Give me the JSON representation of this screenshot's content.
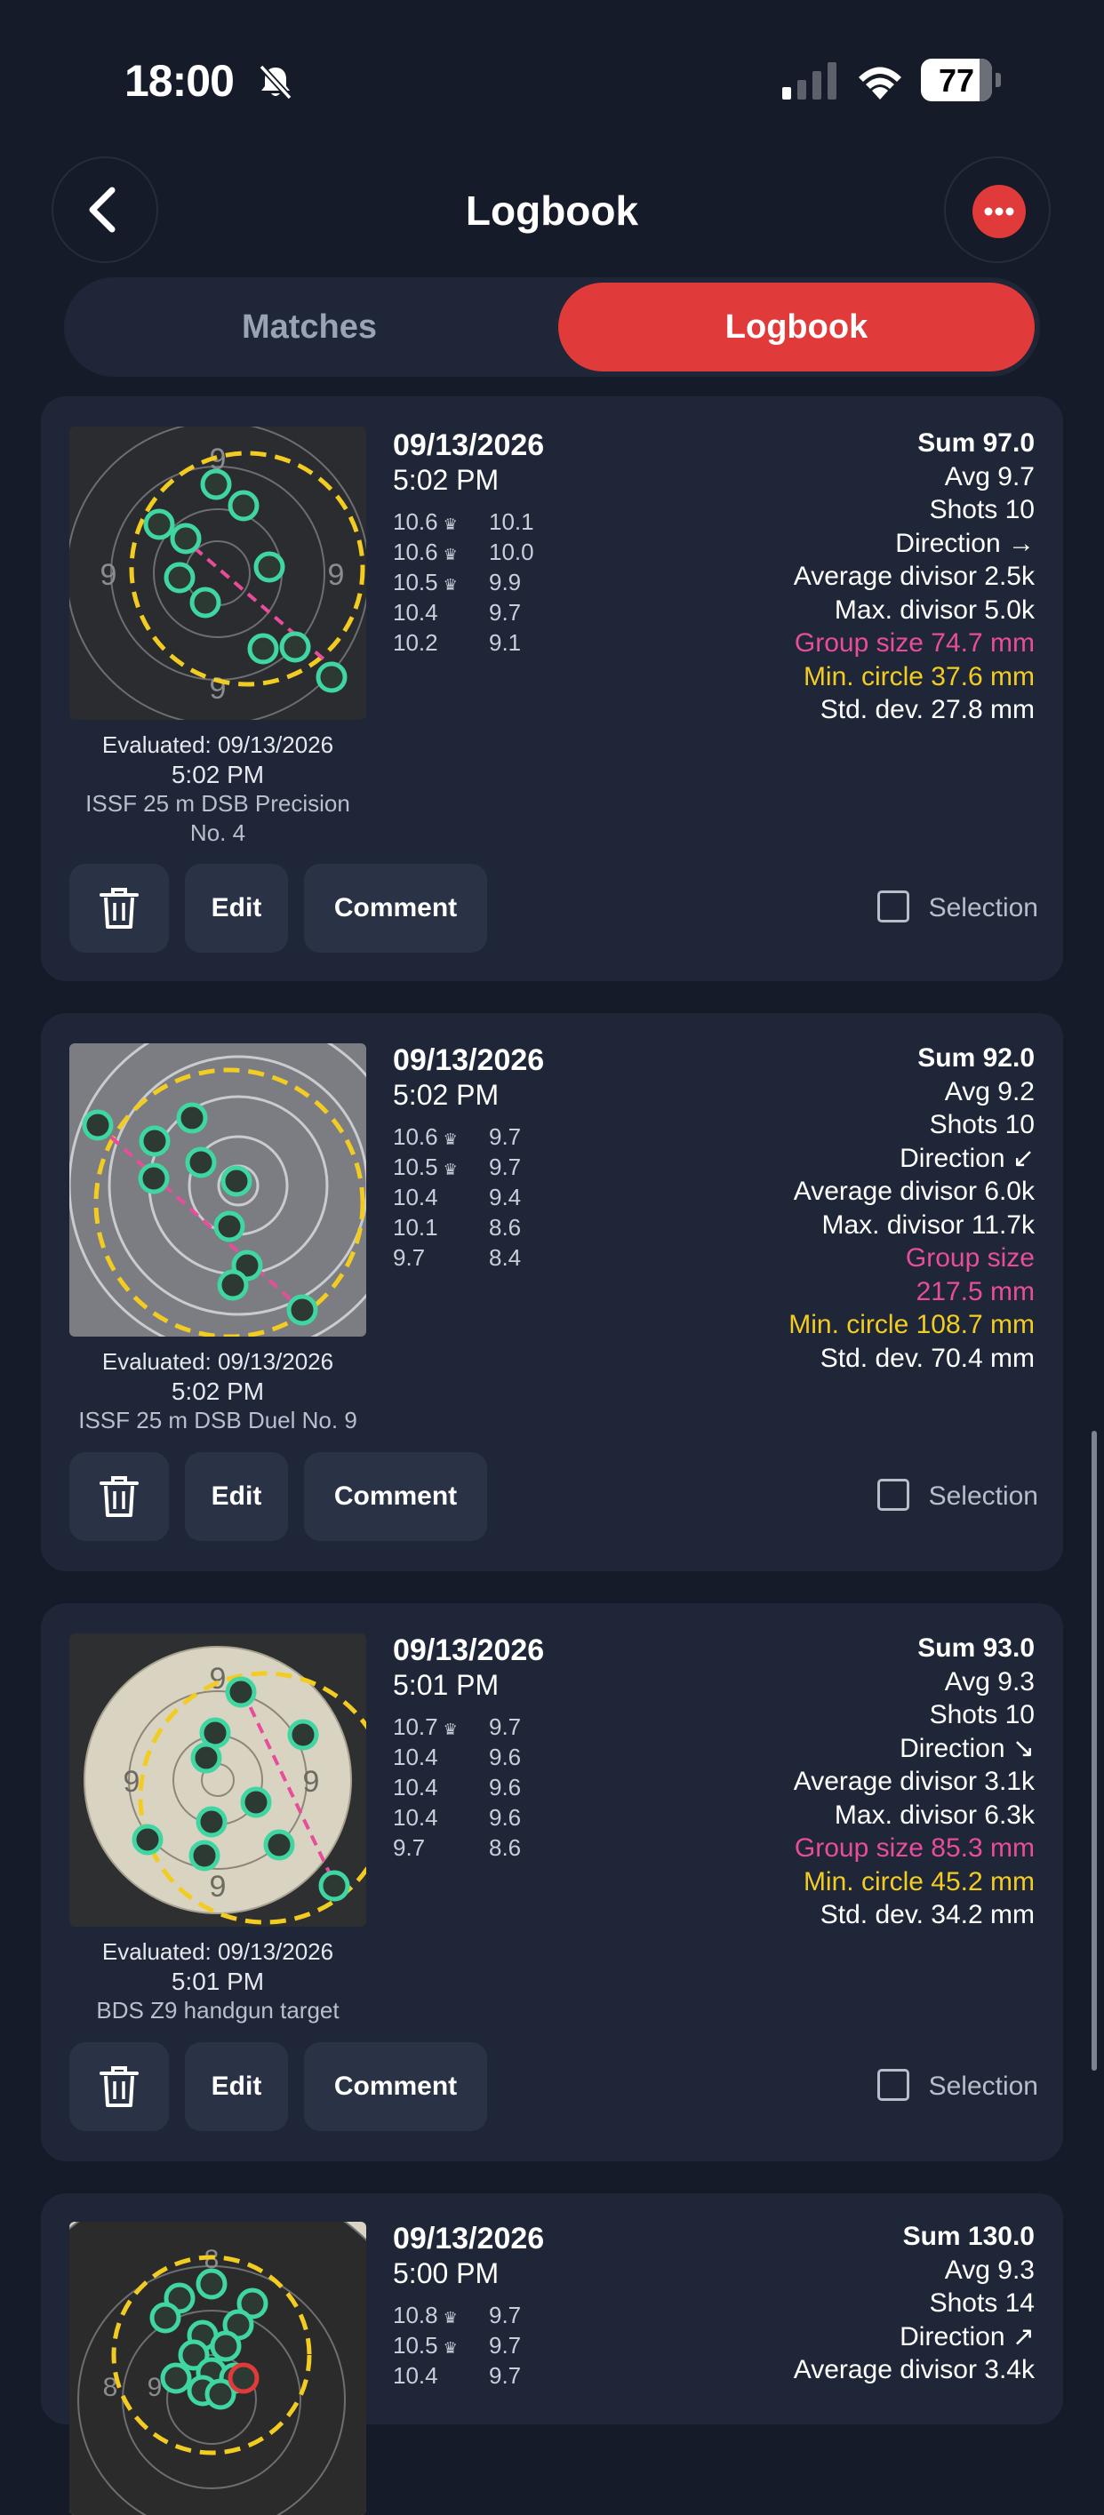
{
  "status_bar": {
    "time": "18:00",
    "battery": "77",
    "battery_level": 0.77,
    "icons": [
      "bell-slash-icon",
      "cellular-signal-icon",
      "wifi-icon",
      "battery-icon"
    ]
  },
  "nav": {
    "title": "Logbook",
    "back_icon": "chevron-left-icon",
    "more_icon": "ellipsis-icon"
  },
  "tabs": [
    {
      "label": "Matches",
      "selected": false
    },
    {
      "label": "Logbook",
      "selected": true
    }
  ],
  "colors": {
    "background": "#151b28",
    "card": "#1e2637",
    "accent": "#e03a3a",
    "group_size": "#e84d9c",
    "min_circle": "#f3cc22",
    "shot_marker": "#3fd6a2"
  },
  "entries": [
    {
      "date": "09/13/2026",
      "time": "5:02 PM",
      "evaluated": "Evaluated: 09/13/2026",
      "evaluated_time": "5:02 PM",
      "target": "ISSF 25 m DSB Precision No. 4",
      "shots": [
        {
          "a": "10.6",
          "a_crown": true,
          "b": "10.1"
        },
        {
          "a": "10.6",
          "a_crown": true,
          "b": "10.0"
        },
        {
          "a": "10.5",
          "a_crown": true,
          "b": "9.9"
        },
        {
          "a": "10.4",
          "a_crown": false,
          "b": "9.7"
        },
        {
          "a": "10.2",
          "a_crown": false,
          "b": "9.1"
        }
      ],
      "stats": {
        "sum": "Sum 97.0",
        "avg": "Avg 9.7",
        "shots": "Shots 10",
        "direction": "Direction →",
        "avg_divisor": "Average divisor 2.5k",
        "max_divisor": "Max. divisor 5.0k",
        "group_size": "Group size 74.7 mm",
        "min_circle": "Min. circle 37.6 mm",
        "std_dev": "Std. dev. 27.8 mm"
      },
      "actions": {
        "edit": "Edit",
        "comment": "Comment",
        "selection": "Selection"
      }
    },
    {
      "date": "09/13/2026",
      "time": "5:02 PM",
      "evaluated": "Evaluated: 09/13/2026",
      "evaluated_time": "5:02 PM",
      "target": "ISSF 25 m DSB Duel No. 9",
      "shots": [
        {
          "a": "10.6",
          "a_crown": true,
          "b": "9.7"
        },
        {
          "a": "10.5",
          "a_crown": true,
          "b": "9.7"
        },
        {
          "a": "10.4",
          "a_crown": false,
          "b": "9.4"
        },
        {
          "a": "10.1",
          "a_crown": false,
          "b": "8.6"
        },
        {
          "a": "9.7",
          "a_crown": false,
          "b": "8.4"
        }
      ],
      "stats": {
        "sum": "Sum 92.0",
        "avg": "Avg 9.2",
        "shots": "Shots 10",
        "direction": "Direction ↙",
        "avg_divisor": "Average divisor 6.0k",
        "max_divisor": "Max. divisor 11.7k",
        "group_size_line1": "Group size",
        "group_size_line2": "217.5 mm",
        "min_circle": "Min. circle 108.7 mm",
        "std_dev": "Std. dev. 70.4 mm"
      },
      "actions": {
        "edit": "Edit",
        "comment": "Comment",
        "selection": "Selection"
      }
    },
    {
      "date": "09/13/2026",
      "time": "5:01 PM",
      "evaluated": "Evaluated: 09/13/2026",
      "evaluated_time": "5:01 PM",
      "target": "BDS Z9 handgun target",
      "shots": [
        {
          "a": "10.7",
          "a_crown": true,
          "b": "9.7"
        },
        {
          "a": "10.4",
          "a_crown": false,
          "b": "9.6"
        },
        {
          "a": "10.4",
          "a_crown": false,
          "b": "9.6"
        },
        {
          "a": "10.4",
          "a_crown": false,
          "b": "9.6"
        },
        {
          "a": "9.7",
          "a_crown": false,
          "b": "8.6"
        }
      ],
      "stats": {
        "sum": "Sum 93.0",
        "avg": "Avg 9.3",
        "shots": "Shots 10",
        "direction": "Direction ↘",
        "avg_divisor": "Average divisor 3.1k",
        "max_divisor": "Max. divisor 6.3k",
        "group_size": "Group size 85.3 mm",
        "min_circle": "Min. circle 45.2 mm",
        "std_dev": "Std. dev. 34.2 mm"
      },
      "actions": {
        "edit": "Edit",
        "comment": "Comment",
        "selection": "Selection"
      }
    },
    {
      "date": "09/13/2026",
      "time": "5:00 PM",
      "shots": [
        {
          "a": "10.8",
          "a_crown": true,
          "b": "9.7"
        },
        {
          "a": "10.5",
          "a_crown": true,
          "b": "9.7"
        },
        {
          "a": "10.4",
          "a_crown": false,
          "b": "9.7"
        }
      ],
      "stats": {
        "sum": "Sum 130.0",
        "avg": "Avg 9.3",
        "shots": "Shots 14",
        "direction": "Direction ↗",
        "avg_divisor": "Average divisor 3.4k"
      }
    }
  ]
}
